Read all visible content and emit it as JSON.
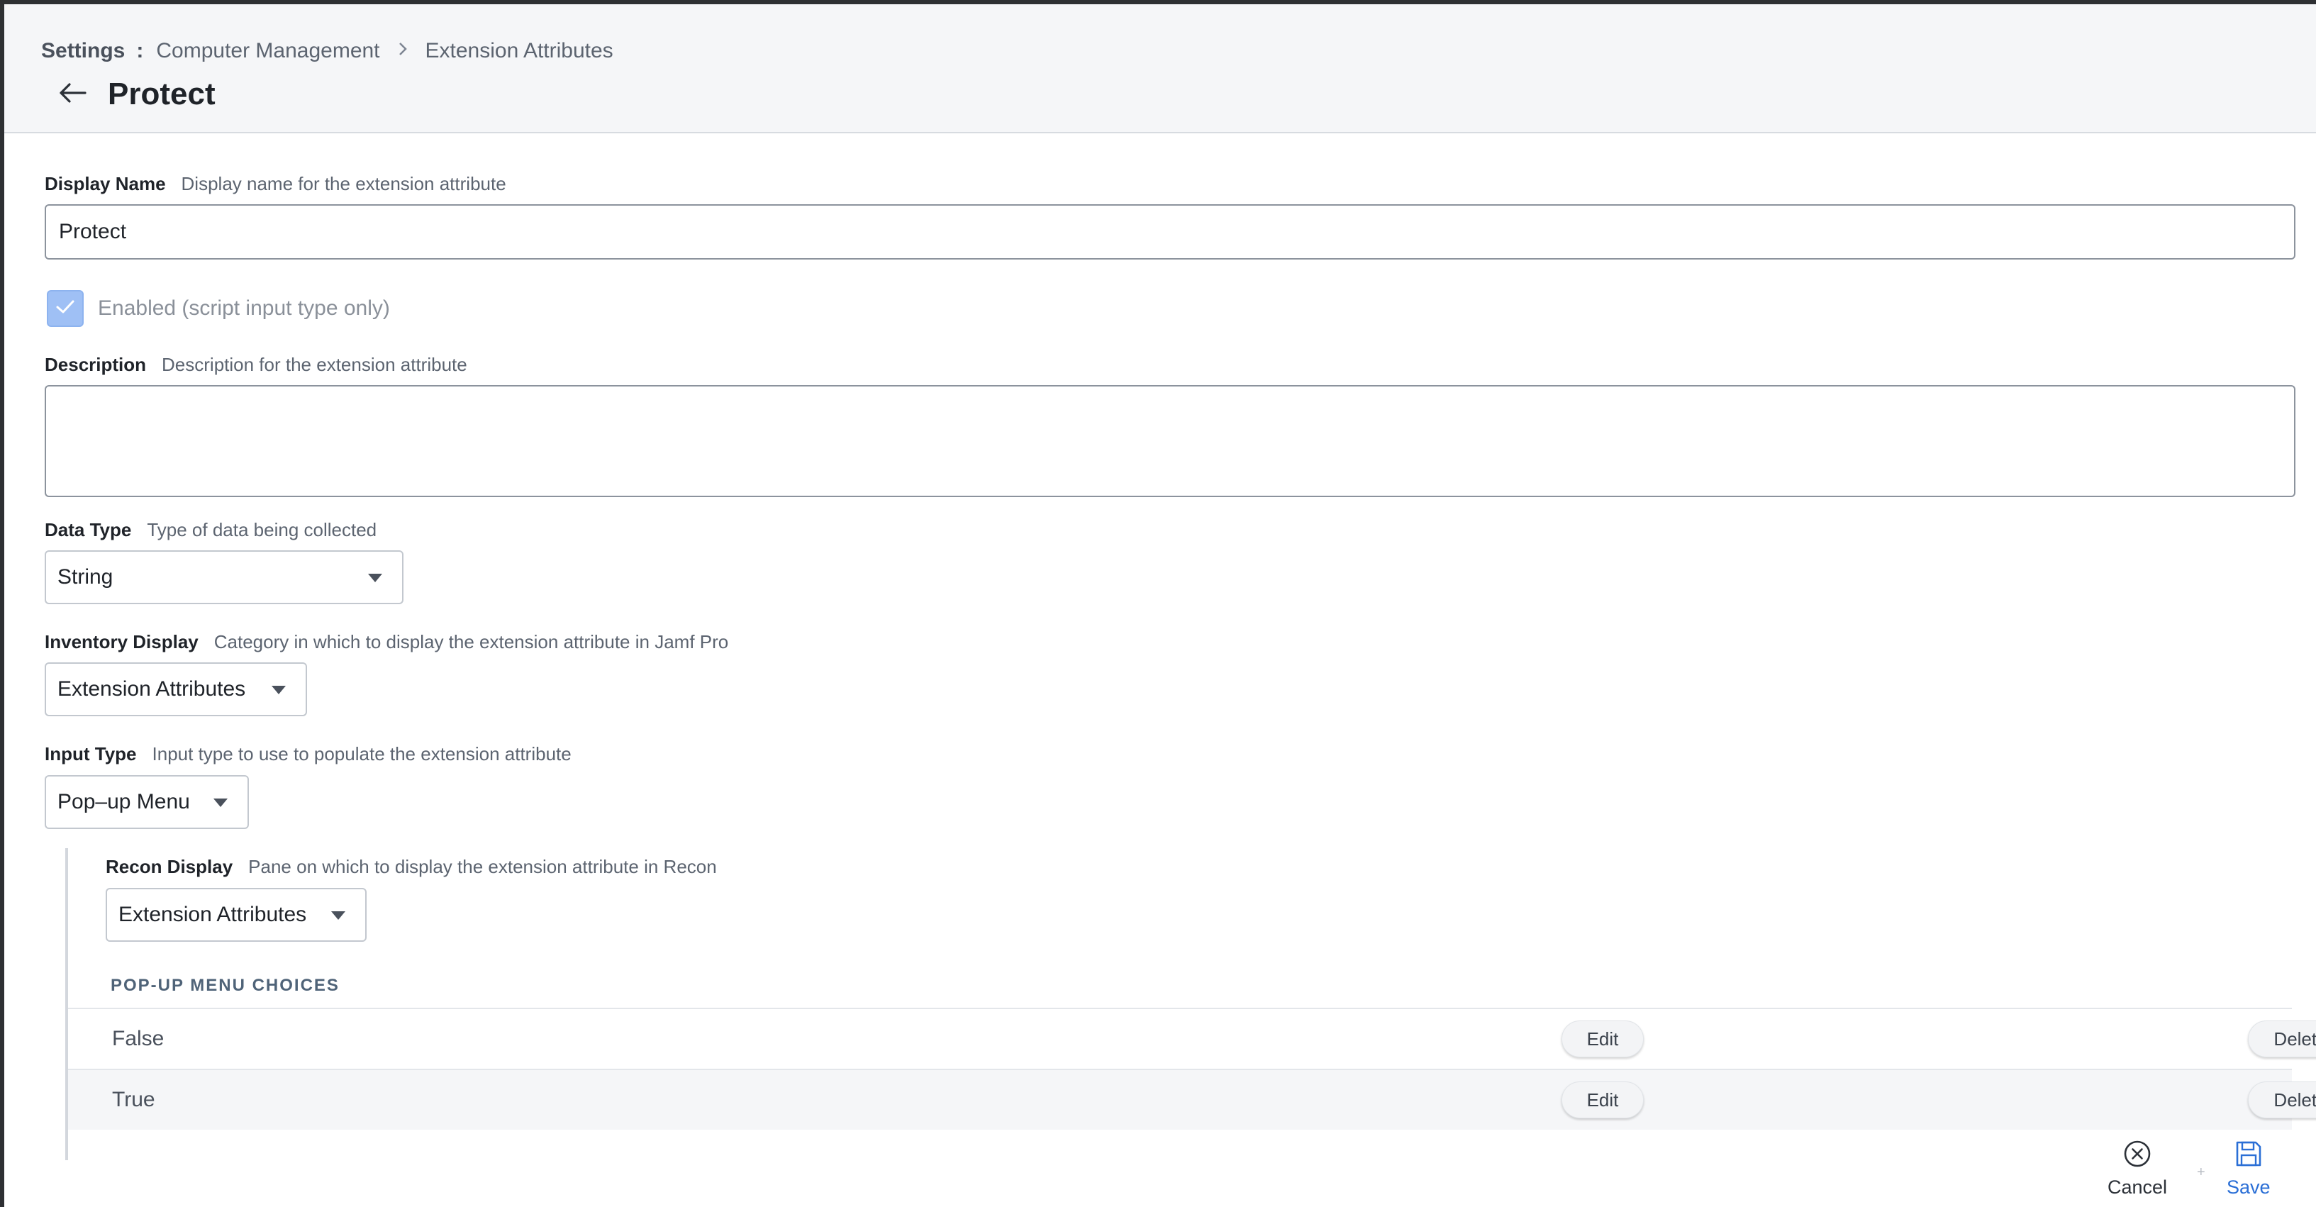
{
  "breadcrumb": {
    "root": "Settings",
    "sep_colon": ":",
    "level1": "Computer Management",
    "level2": "Extension Attributes"
  },
  "page": {
    "title": "Protect"
  },
  "form": {
    "display_name": {
      "label": "Display Name",
      "hint": "Display name for the extension attribute",
      "value": "Protect"
    },
    "enabled": {
      "label": "Enabled (script input type only)",
      "checked": true
    },
    "description": {
      "label": "Description",
      "hint": "Description for the extension attribute",
      "value": ""
    },
    "data_type": {
      "label": "Data Type",
      "hint": "Type of data being collected",
      "value": "String"
    },
    "inventory_display": {
      "label": "Inventory Display",
      "hint": "Category in which to display the extension attribute in Jamf Pro",
      "value": "Extension Attributes"
    },
    "input_type": {
      "label": "Input Type",
      "hint": "Input type to use to populate the extension attribute",
      "value": "Pop–up Menu"
    },
    "recon_display": {
      "label": "Recon Display",
      "hint": "Pane on which to display the extension attribute in Recon",
      "value": "Extension Attributes"
    }
  },
  "choices": {
    "heading": "POP-UP MENU CHOICES",
    "edit_label": "Edit",
    "delete_label": "Delete",
    "items": [
      {
        "label": "False"
      },
      {
        "label": "True"
      }
    ]
  },
  "footer": {
    "cancel_label": "Cancel",
    "save_label": "Save",
    "mark": "+"
  },
  "colors": {
    "accent": "#2b6fd6",
    "checkbox_fill": "#9fc0f5",
    "header_bg": "#f5f6f8"
  },
  "icons": {
    "back": "arrow-left-icon",
    "breadcrumb_separator": "chevron-right-icon",
    "checkbox": "checkmark-icon",
    "dropdown": "caret-down-icon",
    "cancel": "close-circle-icon",
    "save": "floppy-disk-icon"
  }
}
